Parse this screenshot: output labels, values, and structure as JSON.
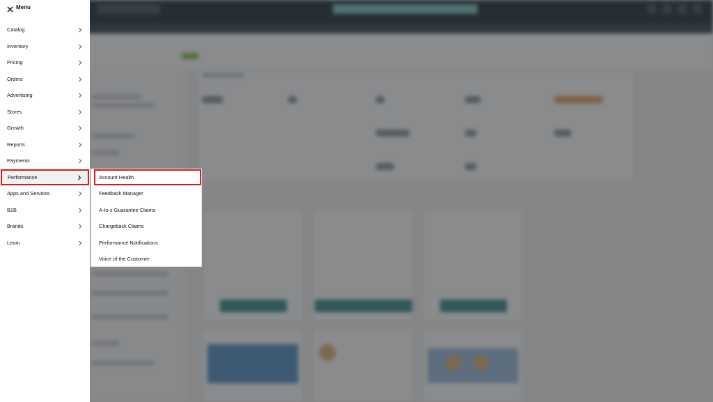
{
  "menu": {
    "title": "Menu",
    "close_icon": "close-icon",
    "items": [
      {
        "label": "Catalog"
      },
      {
        "label": "Inventory"
      },
      {
        "label": "Pricing"
      },
      {
        "label": "Orders"
      },
      {
        "label": "Advertising"
      },
      {
        "label": "Stores"
      },
      {
        "label": "Growth"
      },
      {
        "label": "Reports"
      },
      {
        "label": "Payments"
      },
      {
        "label": "Performance"
      },
      {
        "label": "Apps and Services"
      },
      {
        "label": "B2B"
      },
      {
        "label": "Brands"
      },
      {
        "label": "Learn"
      }
    ],
    "selected": "Performance"
  },
  "submenu": {
    "parent": "Performance",
    "items": [
      {
        "label": "Account Health"
      },
      {
        "label": "Feedback Manager"
      },
      {
        "label": "A-to-z Guarantee Claims"
      },
      {
        "label": "Chargeback Claims"
      },
      {
        "label": "Performance Notifications"
      },
      {
        "label": "Voice of the Customer"
      }
    ],
    "highlighted": "Account Health"
  },
  "colors": {
    "highlight_border": "#e0181b",
    "topbar": "#23313a",
    "overlay": "rgba(40,44,48,0.55)"
  }
}
